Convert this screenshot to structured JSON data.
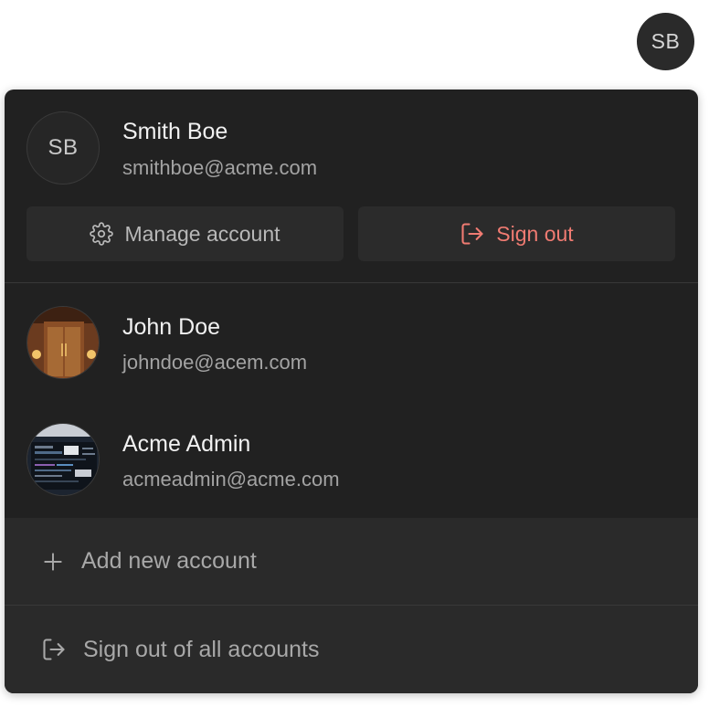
{
  "trigger": {
    "initials": "SB"
  },
  "current_account": {
    "initials": "SB",
    "name": "Smith Boe",
    "email": "smithboe@acme.com",
    "manage_label": "Manage account",
    "signout_label": "Sign out"
  },
  "other_accounts": [
    {
      "name": "John Doe",
      "email": "johndoe@acem.com",
      "avatar_icon": "door-photo-avatar"
    },
    {
      "name": "Acme Admin",
      "email": "acmeadmin@acme.com",
      "avatar_icon": "code-screen-photo-avatar"
    }
  ],
  "footer": {
    "add_label": "Add new account",
    "signout_all_label": "Sign out of all accounts"
  },
  "colors": {
    "menu_bg": "#212121",
    "danger": "#f07b72",
    "footer_bg": "#2a2a2a"
  }
}
